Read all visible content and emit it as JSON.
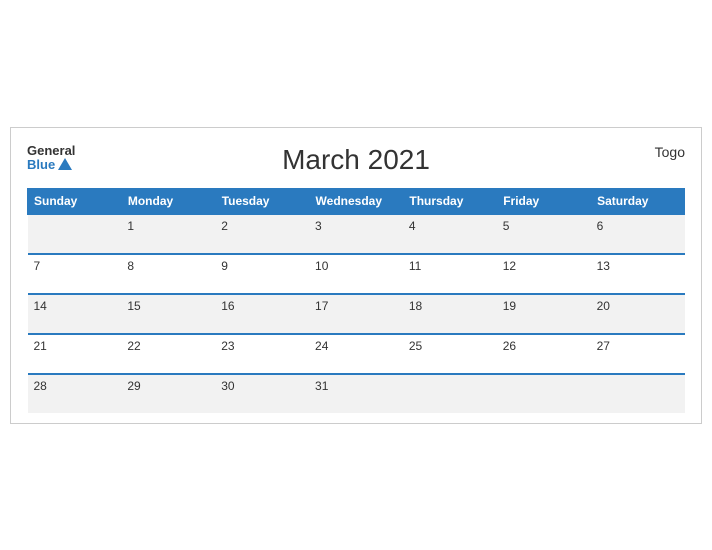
{
  "brand": {
    "general": "General",
    "blue": "Blue",
    "triangle": "▲"
  },
  "country": "Togo",
  "title": "March 2021",
  "days_of_week": [
    "Sunday",
    "Monday",
    "Tuesday",
    "Wednesday",
    "Thursday",
    "Friday",
    "Saturday"
  ],
  "weeks": [
    [
      "",
      "1",
      "2",
      "3",
      "4",
      "5",
      "6"
    ],
    [
      "7",
      "8",
      "9",
      "10",
      "11",
      "12",
      "13"
    ],
    [
      "14",
      "15",
      "16",
      "17",
      "18",
      "19",
      "20"
    ],
    [
      "21",
      "22",
      "23",
      "24",
      "25",
      "26",
      "27"
    ],
    [
      "28",
      "29",
      "30",
      "31",
      "",
      "",
      ""
    ]
  ]
}
